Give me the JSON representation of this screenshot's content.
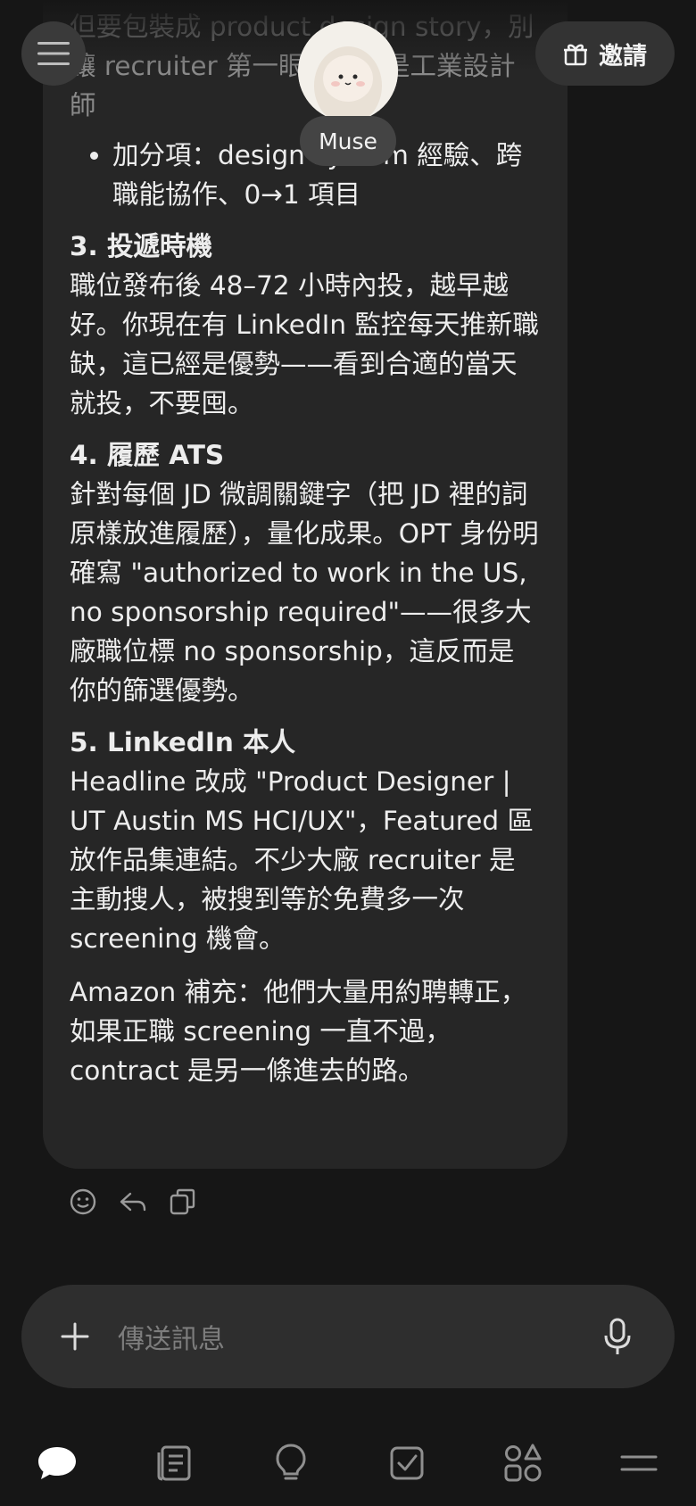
{
  "header": {
    "assistant_name": "Muse",
    "invite_label": "邀請"
  },
  "message": {
    "faded_para": "但要包裝成 product design story，別讓 recruiter 第一眼以為你是工業設計師",
    "bullet": "加分項：design system 經驗、跨職能協作、0→1 項目",
    "sections": [
      {
        "title": "3. 投遞時機",
        "body": "職位發布後 48–72 小時內投，越早越好。你現在有 LinkedIn 監控每天推新職缺，這已經是優勢——看到合適的當天就投，不要囤。"
      },
      {
        "title": "4. 履歷 ATS",
        "body": "針對每個 JD 微調關鍵字（把 JD 裡的詞原樣放進履歷），量化成果。OPT 身份明確寫 \"authorized to work in the US, no sponsorship required\"——很多大廠職位標 no sponsorship，這反而是你的篩選優勢。"
      },
      {
        "title": "5. LinkedIn 本人",
        "body": "Headline 改成 \"Product Designer | UT Austin MS HCI/UX\"，Featured 區放作品集連結。不少大廠 recruiter 是主動搜人，被搜到等於免費多一次 screening 機會。"
      }
    ],
    "closing": "Amazon 補充：他們大量用約聘轉正，如果正職 screening 一直不過，contract 是另一條進去的路。"
  },
  "composer": {
    "placeholder": "傳送訊息"
  },
  "icons": {
    "menu": "hamburger-icon",
    "gift": "gift-icon",
    "emoji": "smiley-icon",
    "reply": "reply-icon",
    "copy": "copy-icon",
    "plus": "plus-icon",
    "mic": "mic-icon"
  }
}
